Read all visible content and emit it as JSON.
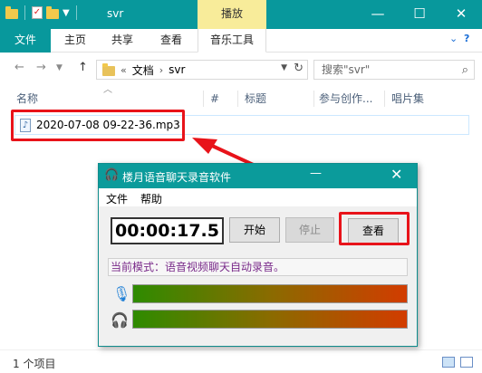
{
  "explorer": {
    "title": "svr",
    "context_tab": "播放",
    "tabs": [
      "文件",
      "主页",
      "共享",
      "查看",
      "音乐工具"
    ],
    "breadcrumb": [
      "«",
      "文档",
      "›",
      "svr"
    ],
    "search_placeholder": "搜索\"svr\"",
    "columns": [
      "名称",
      "#",
      "标题",
      "参与创作...",
      "唱片集"
    ],
    "files": [
      {
        "name": "2020-07-08 09-22-36.mp3"
      }
    ],
    "status": "1 个项目"
  },
  "recorder": {
    "title": "楼月语音聊天录音软件",
    "menu": [
      "文件",
      "帮助"
    ],
    "timer": "00:00:17.5",
    "buttons": {
      "start": "开始",
      "stop": "停止",
      "view": "查看"
    },
    "mode_text": "当前模式：语音视频聊天自动录音。"
  },
  "colors": {
    "accent": "#08989c",
    "highlight": "#e8131a",
    "mode_text": "#7a2b8a"
  }
}
